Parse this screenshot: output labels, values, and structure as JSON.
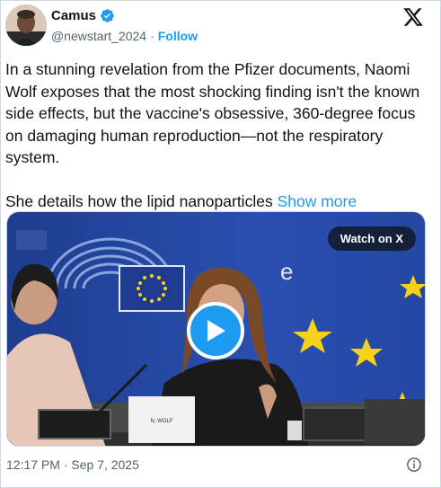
{
  "author": {
    "display_name": "Camus",
    "handle": "@newstart_2024",
    "separator": "·",
    "follow_label": "Follow",
    "verified_icon": "verified-badge-icon"
  },
  "tweet": {
    "paragraph1": "In a stunning revelation from the Pfizer documents, Naomi Wolf exposes that the most shocking finding isn't the known side effects, but the vaccine's obsessive, 360-degree focus on damaging human reproduction—not the respiratory system.",
    "paragraph2": "She details how the lipid nanoparticles",
    "show_more_label": "Show more"
  },
  "media": {
    "watch_label": "Watch on X",
    "nameplate": "N. WOLF",
    "play_icon": "play-icon"
  },
  "footer": {
    "timestamp": "12:17 PM · Sep 7, 2025",
    "info_icon": "info-icon"
  },
  "colors": {
    "accent": "#1d9bf0",
    "text": "#0f1419",
    "secondary": "#536471",
    "eu_blue": "#1e3b8f",
    "eu_yellow": "#f7d117"
  }
}
